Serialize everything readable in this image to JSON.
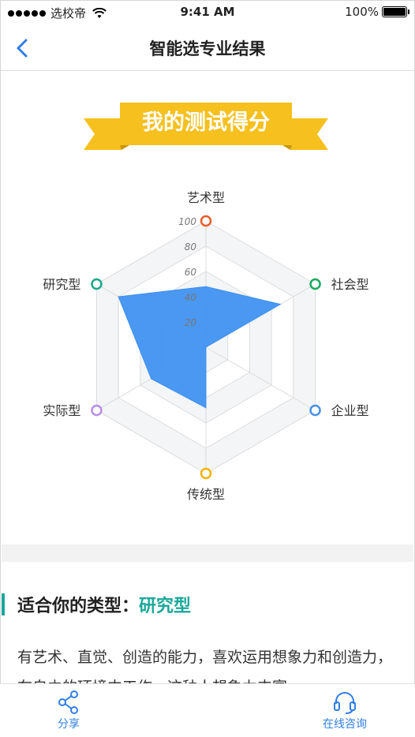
{
  "status_bar": {
    "carrier": "选校帝",
    "time": "9:41 AM",
    "battery": "100%"
  },
  "nav": {
    "back_icon": "chevron-left-icon",
    "title": "智能选专业结果"
  },
  "banner": {
    "title": "我的测试得分"
  },
  "chart_data": {
    "type": "radar",
    "axes": [
      "艺术型",
      "社会型",
      "企业型",
      "传统型",
      "实际型",
      "研究型"
    ],
    "scale": {
      "min": 0,
      "max": 100,
      "ticks": [
        20,
        40,
        60,
        80,
        100
      ]
    },
    "values": [
      48,
      68,
      0,
      48,
      50,
      80
    ],
    "axis_colors": [
      "#e85d2a",
      "#18a960",
      "#4a8fe7",
      "#f4b400",
      "#b98ee6",
      "#18a98a"
    ],
    "fill_color": "#3b8ff0",
    "grid": true
  },
  "result": {
    "label": "适合你的类型：",
    "type": "研究型",
    "description": "有艺术、直觉、创造的能力，喜欢运用想象力和创造力，在自由的环境中工作，这种人想象力丰富"
  },
  "bottom_bar": {
    "share_label": "分享",
    "consult_label": "在线咨询"
  }
}
